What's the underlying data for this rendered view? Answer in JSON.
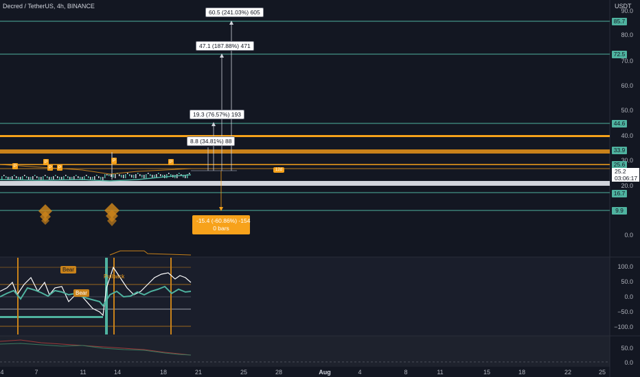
{
  "header": {
    "symbol_title": "Decred / TetherUS, 4h, BINANCE"
  },
  "price_axis": {
    "currency": "USDT",
    "partial_top": "90.0",
    "ticks": [
      "80.0",
      "70.0",
      "60.0",
      "50.0",
      "40.0",
      "30.0",
      "20.0",
      "0.0"
    ],
    "teal_levels": [
      "85.7",
      "72.5",
      "44.6",
      "33.9",
      "25.6",
      "16.7",
      "9.9"
    ],
    "current_price": "25.2",
    "countdown": "03:06:17"
  },
  "callouts": {
    "target_1": "8.8 (34.81%) 88",
    "target_2": "19.3 (76.57%) 193",
    "target_3": "47.1 (187.88%) 471",
    "target_4": "60.5 (241.03%) 605",
    "downside_line1": "-15.4 (-60.86%) -154",
    "downside_line2": "0 bars",
    "orange_box": "12d"
  },
  "markers": {
    "label": "P"
  },
  "oscillator": {
    "ticks": [
      "100.0",
      "50.0",
      "0.0",
      "−50.0",
      "−100.0"
    ],
    "bear_label_1": "Bear",
    "bear_label_2": "Bear",
    "pullback_label": "Pullback"
  },
  "lower_pane": {
    "ticks": [
      "50.0",
      "0.0"
    ]
  },
  "time_axis": {
    "labels": [
      "4",
      "7",
      "11",
      "14",
      "18",
      "21",
      "25",
      "28",
      "Aug",
      "4",
      "8",
      "11",
      "15",
      "18",
      "22",
      "25"
    ]
  },
  "colors": {
    "background": "#131722",
    "teal": "#4fb3a0",
    "orange": "#f7a21b",
    "white": "#ffffff",
    "gray": "#787b86"
  }
}
